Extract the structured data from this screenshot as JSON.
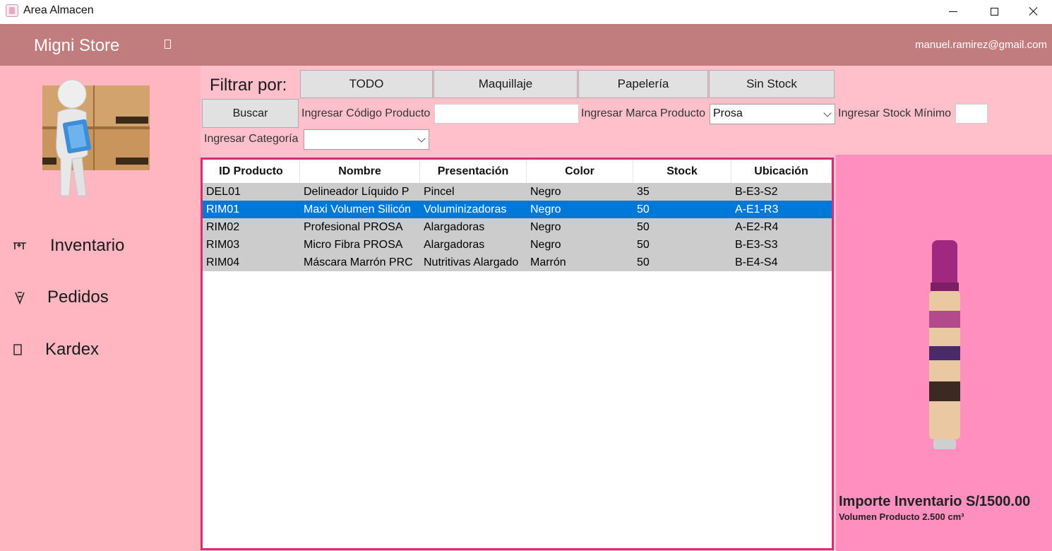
{
  "window": {
    "title": "Area Almacen"
  },
  "header": {
    "brand": "Migni Store",
    "user_email": "manuel.ramirez@gmail.com"
  },
  "sidebar": {
    "items": [
      {
        "label": "Inventario",
        "icon": "inventory-icon"
      },
      {
        "label": "Pedidos",
        "icon": "orders-icon"
      },
      {
        "label": "Kardex",
        "icon": "kardex-icon"
      }
    ]
  },
  "filters": {
    "title": "Filtrar por:",
    "buttons": [
      "TODO",
      "Maquillaje",
      "Papelería",
      "Sin Stock"
    ],
    "search_button": "Buscar",
    "code_label": "Ingresar Código Producto",
    "code_value": "",
    "brand_label": "Ingresar Marca Producto",
    "brand_value": "Prosa",
    "min_stock_label": "Ingresar Stock Mínimo",
    "min_stock_value": "",
    "category_label": "Ingresar Categoría",
    "category_value": ""
  },
  "table": {
    "columns": [
      "ID Producto",
      "Nombre",
      "Presentación",
      "Color",
      "Stock",
      "Ubicación"
    ],
    "rows": [
      [
        "DEL01",
        "Delineador Líquido P",
        "Pincel",
        "Negro",
        "35",
        "B-E3-S2"
      ],
      [
        "RIM01",
        "Maxi Volumen Silicón",
        "Voluminizadoras",
        "Negro",
        "50",
        "A-E1-R3"
      ],
      [
        "RIM02",
        "Profesional PROSA",
        "Alargadoras",
        "Negro",
        "50",
        "A-E2-R4"
      ],
      [
        "RIM03",
        "Micro Fibra PROSA",
        "Alargadoras",
        "Negro",
        "50",
        "B-E3-S3"
      ],
      [
        "RIM04",
        "Máscara Marrón PRC",
        "Nutritivas Alargado",
        "Marrón",
        "50",
        "B-E4-S4"
      ]
    ],
    "selected_row": 1
  },
  "summary": {
    "importe": "Importe Inventario S/1500.00",
    "volumen": "Volumen Producto 2.500 cm³"
  },
  "colors": {
    "appbar": "#c17d7e",
    "sidebar": "#ffb6c1",
    "filterbar": "#ffc0cb",
    "grid_border": "#d62d7a",
    "right_panel": "#ff8fbf",
    "selected_row": "#0078d7",
    "row": "#cccccc"
  }
}
